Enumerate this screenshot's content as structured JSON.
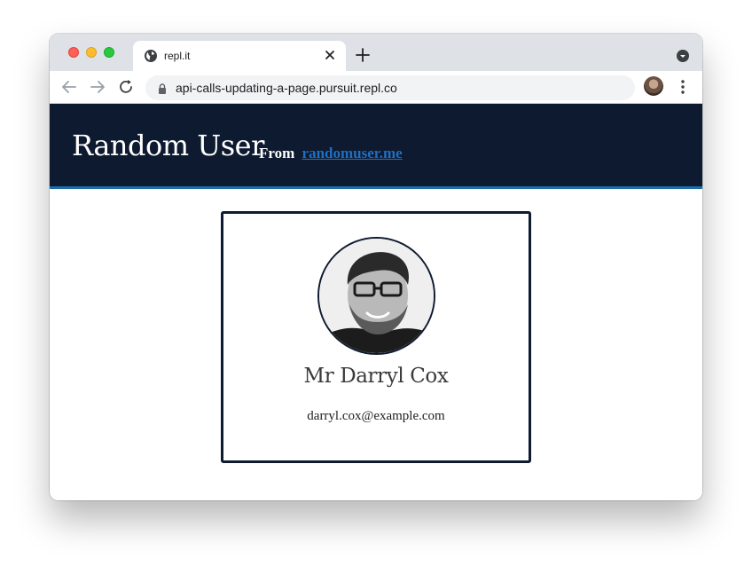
{
  "tab": {
    "title": "repl.it"
  },
  "toolbar": {
    "url": "api-calls-updating-a-page.pursuit.repl.co"
  },
  "header": {
    "title": "Random User",
    "subtitle_prefix": "From",
    "subtitle_link": "randomuser.me"
  },
  "card": {
    "name": "Mr Darryl Cox",
    "email": "darryl.cox@example.com"
  },
  "colors": {
    "header_bg": "#0e1a2f",
    "header_border": "#1a6ea8",
    "link": "#1f6fc4",
    "card_border": "#0e1a2f"
  },
  "icons": {
    "favicon": "globe-icon",
    "tab_close": "close-icon",
    "new_tab": "plus-icon",
    "back": "back-arrow-icon",
    "forward": "forward-arrow-icon",
    "reload": "reload-icon",
    "lock": "lock-icon",
    "bookmark": "star-icon",
    "menu": "kebab-menu-icon"
  }
}
